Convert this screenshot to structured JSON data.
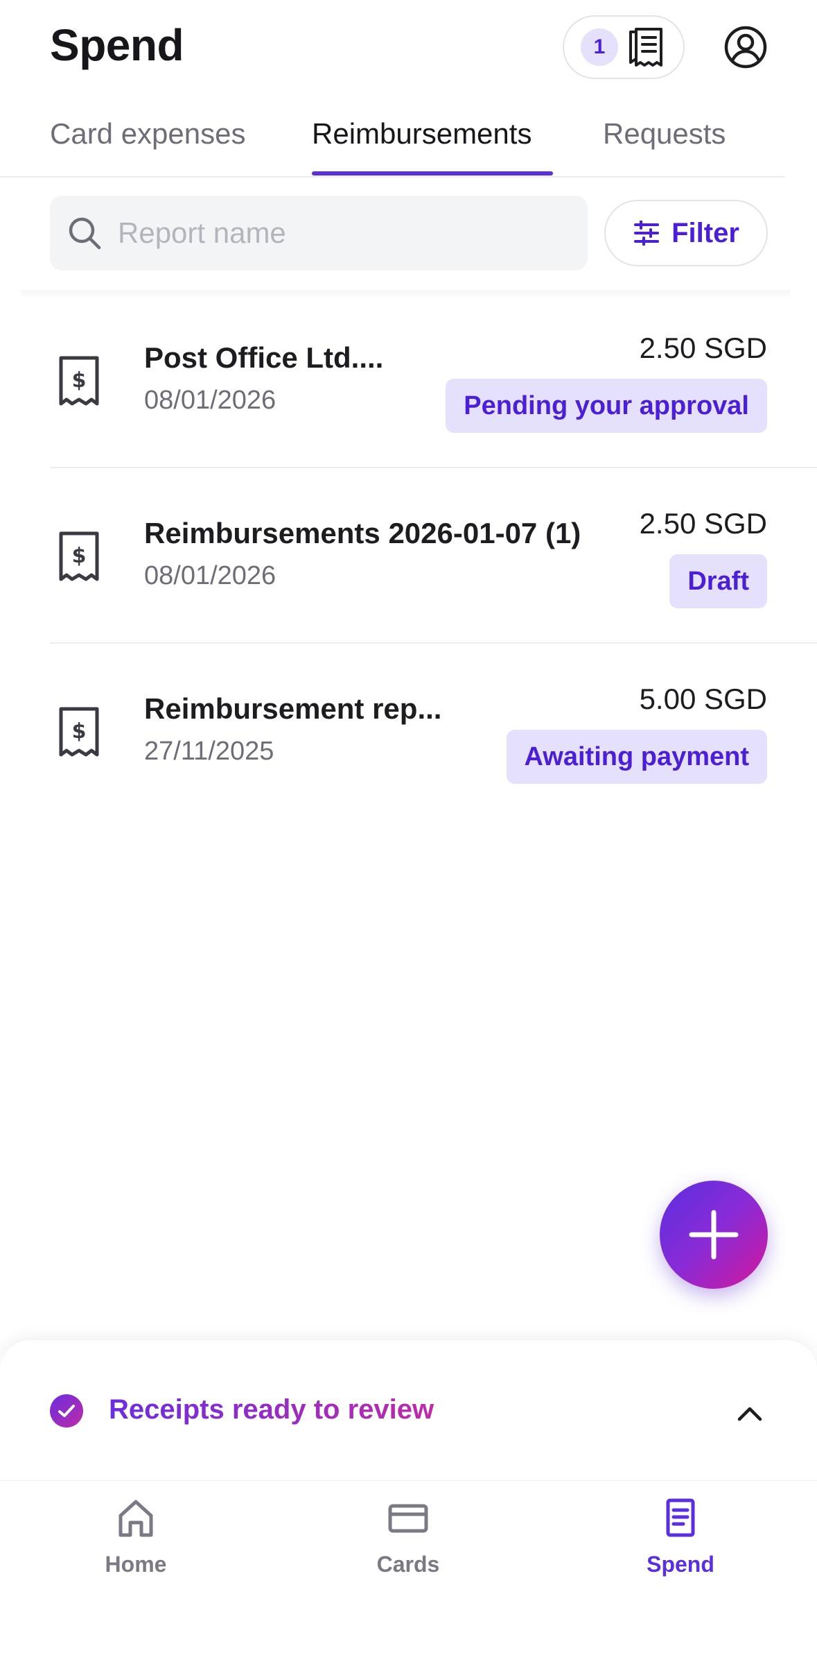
{
  "header": {
    "title": "Spend",
    "receipts_count": "1"
  },
  "tabs": [
    {
      "label": "Card expenses"
    },
    {
      "label": "Reimbursements"
    },
    {
      "label": "Requests"
    }
  ],
  "search": {
    "placeholder": "Report name",
    "value": ""
  },
  "filter": {
    "label": "Filter"
  },
  "reports": [
    {
      "title": "Post Office Ltd....",
      "date": "08/01/2026",
      "amount": "2.50 SGD",
      "status": "Pending your approval"
    },
    {
      "title": "Reimbursements 2026-01-07 (1)",
      "date": "08/01/2026",
      "amount": "2.50 SGD",
      "status": "Draft"
    },
    {
      "title": "Reimbursement rep...",
      "date": "27/11/2025",
      "amount": "5.00 SGD",
      "status": "Awaiting payment"
    }
  ],
  "sheet": {
    "label": "Receipts ready to review"
  },
  "nav": [
    {
      "label": "Home"
    },
    {
      "label": "Cards"
    },
    {
      "label": "Spend"
    }
  ],
  "colors": {
    "accent": "#5b2ee0",
    "badge_bg": "#e5e0fb",
    "badge_text": "#4b1fd6",
    "gradient_end": "#d4179a"
  }
}
